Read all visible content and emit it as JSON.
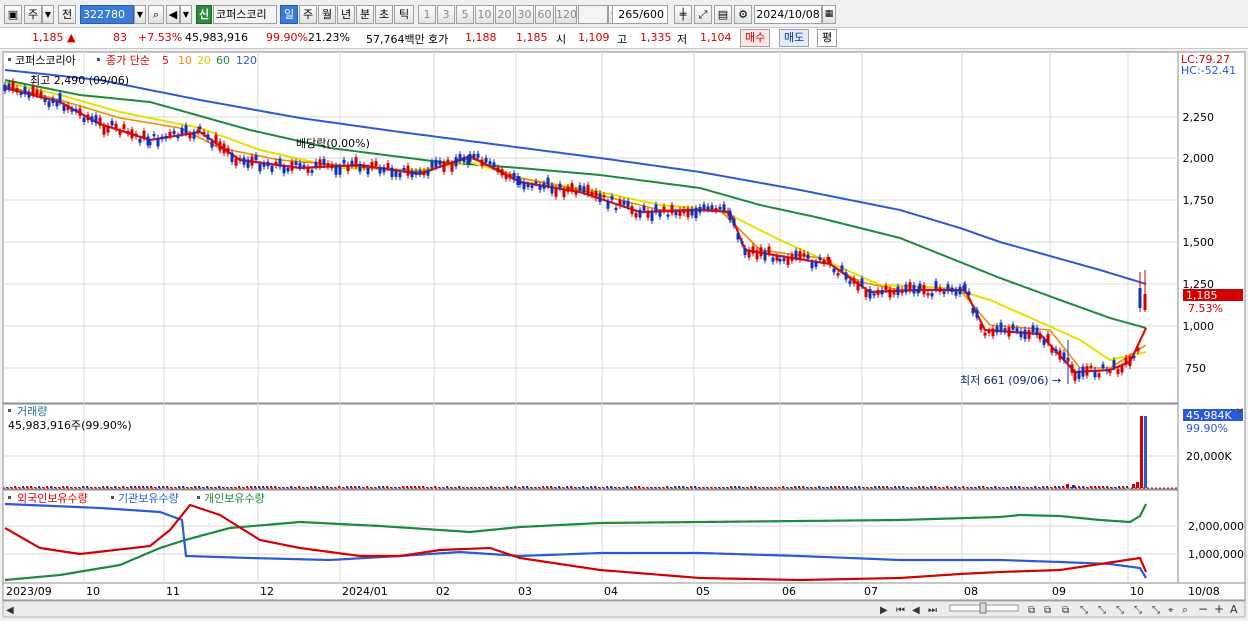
{
  "toolbar": {
    "period_day": "주",
    "prev_label": "전",
    "code": "322780",
    "new_badge": "신",
    "stock_name": "코퍼스코리",
    "periods": [
      "일",
      "주",
      "월",
      "년",
      "분",
      "초",
      "틱"
    ],
    "intervals": [
      "1",
      "3",
      "5",
      "10",
      "20",
      "30",
      "60",
      "120"
    ],
    "count": "265",
    "count_total": "/600",
    "date": "2024/10/08"
  },
  "quote": {
    "price": "1,185",
    "change": "83",
    "change_pct": "+7.53%",
    "volume": "45,983,916",
    "volume_ratio": "99.90%",
    "turnover": "21.23%",
    "amount": "57,764백만",
    "bid_label": "호가",
    "bid_ask": "1,188",
    "bid_bid": "1,185",
    "open_label": "시",
    "open": "1,109",
    "high_label": "고",
    "high": "1,335",
    "low_label": "저",
    "low": "1,104",
    "buy_button": "매수",
    "sell_button": "매도",
    "eval_button": "평"
  },
  "price_panel": {
    "legend_name": "코퍼스코리아",
    "legend_ma": "종가 단순",
    "ma_periods": [
      {
        "p": "5",
        "color": "#e01010"
      },
      {
        "p": "10",
        "color": "#f08c00"
      },
      {
        "p": "20",
        "color": "#e8e000"
      },
      {
        "p": "60",
        "color": "#1e8a3c"
      },
      {
        "p": "120",
        "color": "#2a5ad8"
      }
    ],
    "high_marker": "최고 2,490 (09/06)",
    "low_marker": "최저 661 (09/06)",
    "dividend_label": "배당락(0.00%)",
    "lc_label": "LC:79.27",
    "hc_label": "HC:-52.41",
    "current_price_tag": "1,185",
    "current_pct_tag": "7.53%",
    "y_ticks": [
      "2,250",
      "2,000",
      "1,750",
      "1,500",
      "1,250",
      "1,000",
      "750"
    ]
  },
  "volume_panel": {
    "title": "거래량",
    "value": "45,983,916주(99.90%)",
    "tag_value": "45,984K",
    "tag_pct": "99.90%",
    "y_tick": "20,000K"
  },
  "holding_panel": {
    "legends": [
      {
        "label": "외국인보유수량",
        "color": "#d40000"
      },
      {
        "label": "기관보유수량",
        "color": "#2a5ad8"
      },
      {
        "label": "개인보유수량",
        "color": "#1e8a3c"
      }
    ],
    "y_ticks": [
      "2,000,000",
      "1,000,000"
    ]
  },
  "x_axis": {
    "labels": [
      "2023/09",
      "10",
      "11",
      "12",
      "2024/01",
      "02",
      "03",
      "04",
      "05",
      "06",
      "07",
      "08",
      "09",
      "10"
    ],
    "right_label": "10/08"
  },
  "colors": {
    "ma5": "#e01010",
    "ma10": "#f08c00",
    "ma20": "#e8e000",
    "ma60": "#1e8a3c",
    "ma120": "#2a5ad8",
    "up": "#d40000",
    "down": "#1030c0"
  }
}
